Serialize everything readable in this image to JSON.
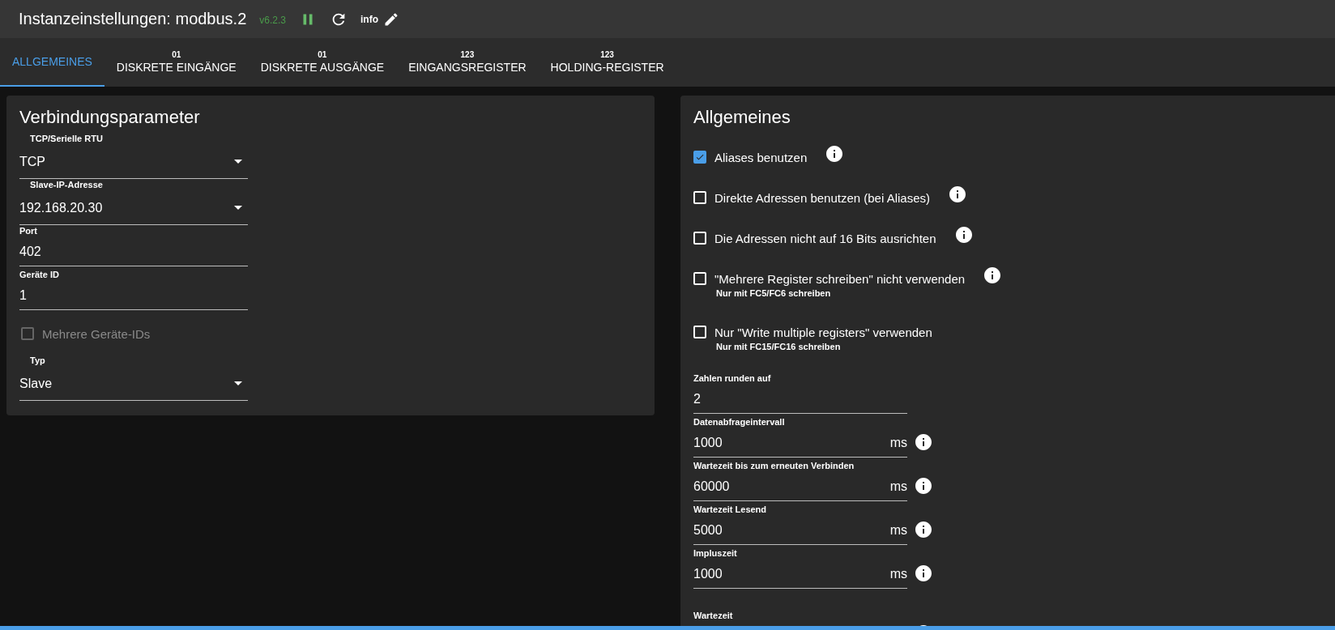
{
  "header": {
    "title": "Instanzeinstellungen: modbus.2",
    "version": "v6.2.3",
    "running": true,
    "info_label": "info"
  },
  "tabs": [
    {
      "label": "ALLGEMEINES",
      "selected": true
    },
    {
      "label": "DISKRETE EINGÄNGE",
      "badge": "01",
      "selected": false
    },
    {
      "label": "DISKRETE AUSGÄNGE",
      "badge": "01",
      "selected": false
    },
    {
      "label": "EINGANGSREGISTER",
      "badge": "123",
      "selected": false
    },
    {
      "label": "HOLDING-REGISTER",
      "badge": "123",
      "selected": false
    }
  ],
  "connection": {
    "title": "Verbindungsparameter",
    "fields": [
      {
        "kind": "select",
        "label": "TCP/Serielle RTU",
        "value": "TCP"
      },
      {
        "kind": "select",
        "label": "Slave-IP-Adresse",
        "value": "192.168.20.30"
      },
      {
        "kind": "text",
        "label": "Port",
        "value": "402"
      },
      {
        "kind": "text",
        "label": "Geräte ID",
        "value": "1"
      },
      {
        "kind": "checkbox",
        "label": "Mehrere Geräte-IDs",
        "checked": false,
        "disabled": true
      },
      {
        "kind": "select",
        "label": "Typ",
        "value": "Slave"
      }
    ]
  },
  "general": {
    "title": "Allgemeines",
    "options": [
      {
        "label": "Aliases benutzen",
        "checked": true,
        "info": true
      },
      {
        "label": "Direkte Adressen benutzen (bei Aliases)",
        "checked": false,
        "info": true
      },
      {
        "label": "Die Adressen nicht auf 16 Bits ausrichten",
        "checked": false,
        "info": true
      },
      {
        "label": "\"Mehrere Register schreiben\" nicht verwenden",
        "checked": false,
        "info": true,
        "hint": "Nur mit FC5/FC6 schreiben"
      },
      {
        "label": "Nur \"Write multiple registers\" verwenden",
        "checked": false,
        "info": false,
        "hint": "Nur mit FC15/FC16 schreiben"
      }
    ],
    "fields": [
      {
        "label": "Zahlen runden auf",
        "value": "2",
        "info": false
      },
      {
        "label": "Datenabfrageintervall",
        "value": "1000",
        "unit": "ms",
        "info": true
      },
      {
        "label": "Wartezeit bis zum erneuten Verbinden",
        "value": "60000",
        "unit": "ms",
        "info": true
      },
      {
        "label": "Wartezeit Lesend",
        "value": "5000",
        "unit": "ms",
        "info": true
      },
      {
        "label": "Impluszeit",
        "value": "1000",
        "unit": "ms",
        "info": true
      },
      {
        "label": "Wartezeit",
        "info": true
      }
    ]
  }
}
